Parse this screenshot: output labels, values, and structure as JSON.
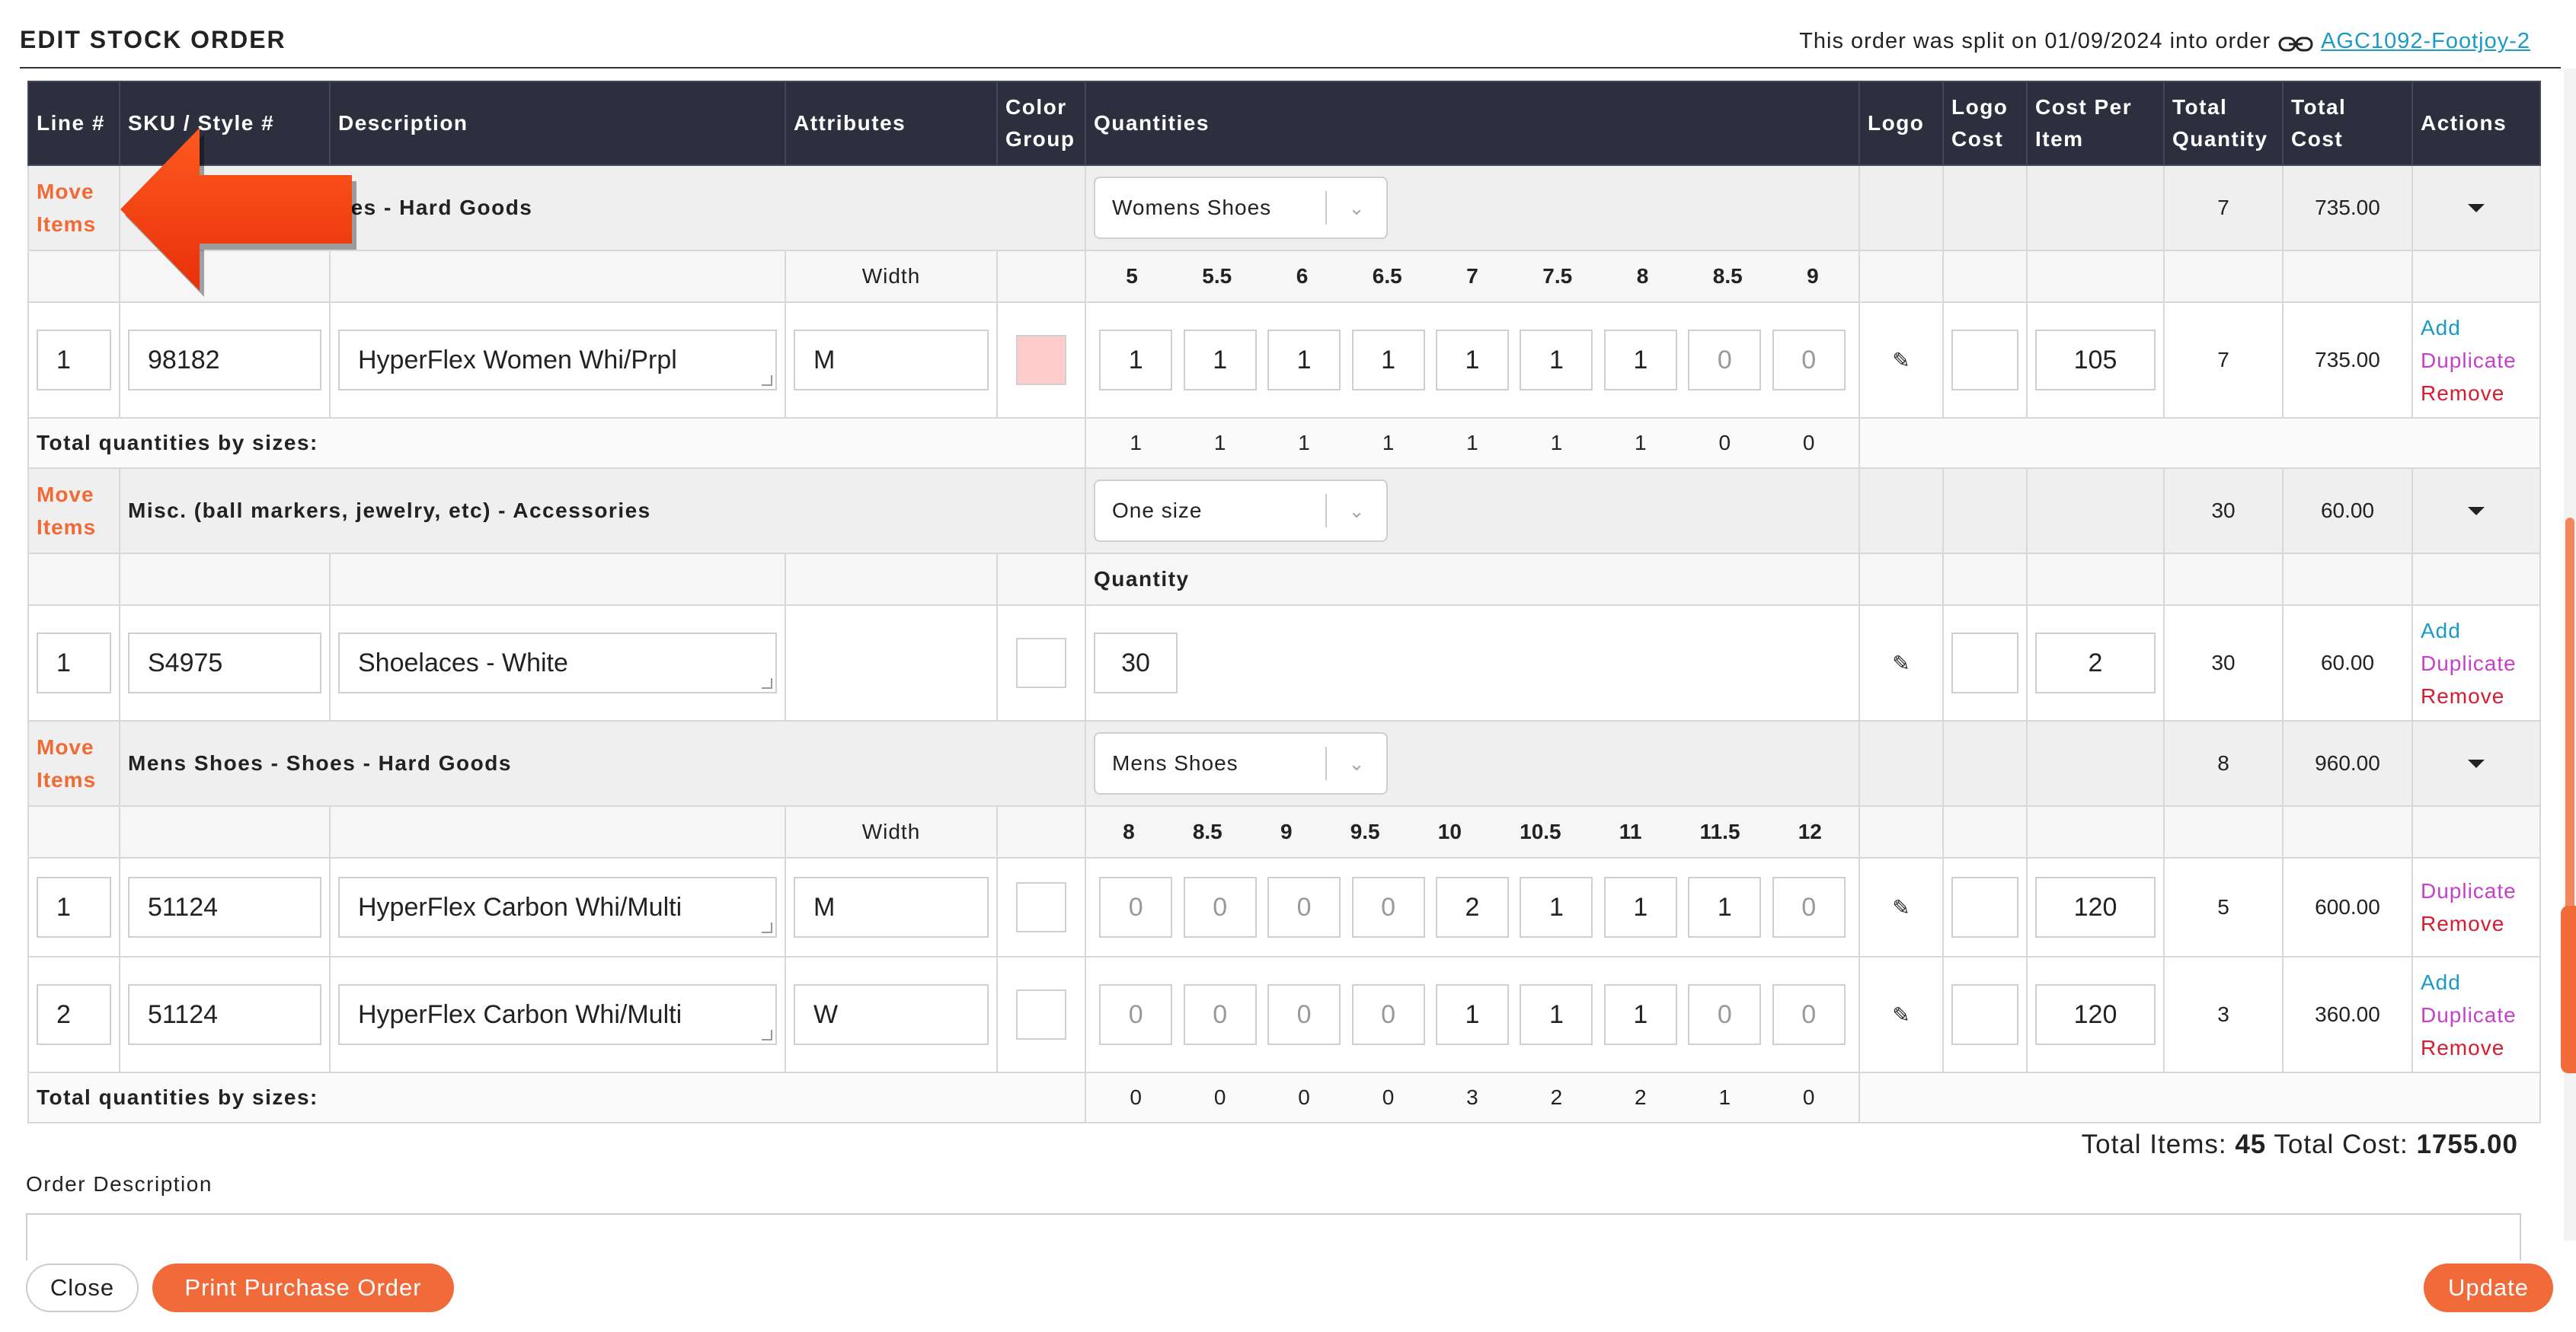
{
  "header": {
    "title": "EDIT STOCK ORDER",
    "split_note": "This order was split on 01/09/2024 into order",
    "split_link": "AGC1092-Footjoy-2"
  },
  "columns": [
    "Line #",
    "SKU / Style #",
    "Description",
    "Attributes",
    "Color Group",
    "Quantities",
    "Logo",
    "Logo Cost",
    "Cost Per Item",
    "Total Quantity",
    "Total Cost",
    "Actions"
  ],
  "move_items": "Move Items",
  "width_label": "Width",
  "quantity_label": "Quantity",
  "totals_by_sizes_label": "Total quantities by sizes:",
  "groups": [
    {
      "name": "Womens Shoes - Shoes - Hard Goods",
      "visible_name": "oes - Hard Goods",
      "selector": "Womens Shoes",
      "total_quantity": "7",
      "total_cost": "735.00",
      "sizes": [
        "5",
        "5.5",
        "6",
        "6.5",
        "7",
        "7.5",
        "8",
        "8.5",
        "9"
      ],
      "items": [
        {
          "line": "1",
          "sku": "98182",
          "description": "HyperFlex Women Whi/Prpl",
          "width": "M",
          "color": "#ffcccc",
          "qty": [
            "1",
            "1",
            "1",
            "1",
            "1",
            "1",
            "1",
            "0",
            "0"
          ],
          "logo_cost": "",
          "cost": "105",
          "total_qty": "7",
          "total_cost": "735.00",
          "actions": [
            "Add",
            "Duplicate",
            "Remove"
          ]
        }
      ],
      "totals": [
        "1",
        "1",
        "1",
        "1",
        "1",
        "1",
        "1",
        "0",
        "0"
      ]
    },
    {
      "name": "Misc. (ball markers, jewelry, etc) - Accessories",
      "selector": "One size",
      "total_quantity": "30",
      "total_cost": "60.00",
      "items": [
        {
          "line": "1",
          "sku": "S4975",
          "description": "Shoelaces - White",
          "qty": "30",
          "logo_cost": "",
          "cost": "2",
          "total_qty": "30",
          "total_cost": "60.00",
          "actions": [
            "Add",
            "Duplicate",
            "Remove"
          ]
        }
      ]
    },
    {
      "name": "Mens Shoes - Shoes - Hard Goods",
      "selector": "Mens Shoes",
      "total_quantity": "8",
      "total_cost": "960.00",
      "sizes": [
        "8",
        "8.5",
        "9",
        "9.5",
        "10",
        "10.5",
        "11",
        "11.5",
        "12"
      ],
      "items": [
        {
          "line": "1",
          "sku": "51124",
          "description": "HyperFlex Carbon Whi/Multi",
          "width": "M",
          "qty": [
            "0",
            "0",
            "0",
            "0",
            "2",
            "1",
            "1",
            "1",
            "0"
          ],
          "logo_cost": "",
          "cost": "120",
          "total_qty": "5",
          "total_cost": "600.00",
          "actions": [
            "Duplicate",
            "Remove"
          ]
        },
        {
          "line": "2",
          "sku": "51124",
          "description": "HyperFlex Carbon Whi/Multi",
          "width": "W",
          "qty": [
            "0",
            "0",
            "0",
            "0",
            "1",
            "1",
            "1",
            "0",
            "0"
          ],
          "logo_cost": "",
          "cost": "120",
          "total_qty": "3",
          "total_cost": "360.00",
          "actions": [
            "Add",
            "Duplicate",
            "Remove"
          ]
        }
      ],
      "totals": [
        "0",
        "0",
        "0",
        "0",
        "3",
        "2",
        "2",
        "1",
        "0"
      ]
    }
  ],
  "summary": {
    "items_label": "Total Items:",
    "items": "45",
    "cost_label": "Total Cost:",
    "cost": "1755.00"
  },
  "order_description_label": "Order Description",
  "buttons": {
    "close": "Close",
    "print": "Print Purchase Order",
    "update": "Update"
  },
  "colors": {
    "accent": "#f16a3a",
    "header_bg": "#2d2f3e",
    "link": "#1a9bc4",
    "duplicate": "#c740c9",
    "remove": "#d81b30"
  }
}
